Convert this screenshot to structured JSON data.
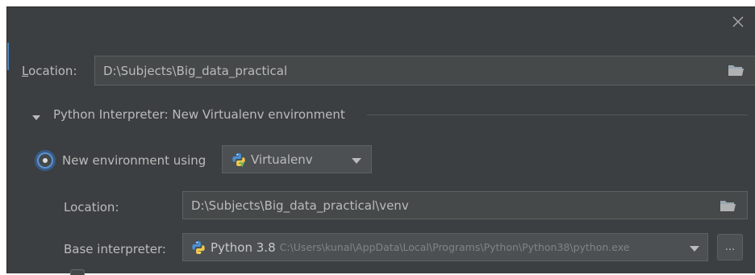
{
  "dialog": {
    "close_icon": "close-x-icon"
  },
  "project": {
    "location_label_mnemonic": "L",
    "location_label_rest": "ocation:",
    "location_value": "D:\\Subjects\\Big_data_practical",
    "browse_icon": "folder-open-icon"
  },
  "interpreter_section": {
    "expand_icon": "triangle-down-icon",
    "title": "Python Interpreter: New Virtualenv environment"
  },
  "new_env": {
    "radio_label": "New environment using",
    "radio_selected": true,
    "tool_icon": "python-virtualenv-icon",
    "tool_value": "Virtualenv",
    "location_label": "Location:",
    "location_value": "D:\\Subjects\\Big_data_practical\\venv",
    "base_interpreter_label": "Base interpreter:",
    "base_interpreter_icon": "python-icon",
    "base_interpreter_name": "Python 3.8",
    "base_interpreter_path": "C:\\Users\\kunal\\AppData\\Local\\Programs\\Python\\Python38\\python.exe",
    "browse_button_label": "..."
  },
  "colors": {
    "background": "#3c3f41",
    "field_background": "#45494a",
    "text": "#bbbbbb",
    "accent": "#4a88c7"
  }
}
